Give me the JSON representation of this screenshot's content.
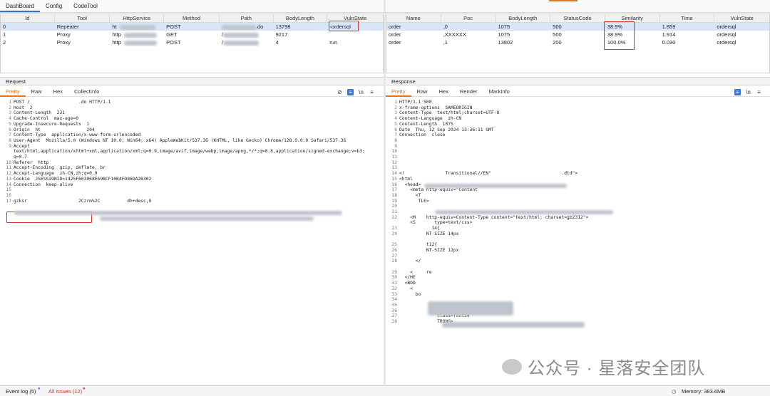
{
  "menu": {
    "tabs": [
      "DashBoard",
      "Config",
      "CodeTool"
    ]
  },
  "left_table": {
    "headers": [
      "Id",
      "Tool",
      "HttpService",
      "Method",
      "Path",
      "BodyLength",
      "VulnState"
    ],
    "rows": [
      {
        "id": "0",
        "tool": "Repeater",
        "http": "ht",
        "method": "POST",
        "path": ".do",
        "body": "13798",
        "vuln": "-ordersql"
      },
      {
        "id": "1",
        "tool": "Proxy",
        "http": "http",
        "method": "GET",
        "path": "/",
        "body": "9217",
        "vuln": ""
      },
      {
        "id": "2",
        "tool": "Proxy",
        "http": "http",
        "method": "POST",
        "path": "/",
        "body": "4",
        "vuln": "run"
      }
    ]
  },
  "right_table": {
    "headers": [
      "Name",
      "Poc",
      "BodyLength",
      "StatusCode",
      "Similarity",
      "Time",
      "VulnState"
    ],
    "rows": [
      {
        "name": "order",
        "poc": ",0",
        "body": "1075",
        "status": "500",
        "sim": "38.9%",
        "time": "1.859",
        "vuln": "ordersql"
      },
      {
        "name": "order",
        "poc": ",XXXXXX",
        "body": "1075",
        "status": "500",
        "sim": "38.9%",
        "time": "1.914",
        "vuln": "ordersql"
      },
      {
        "name": "order",
        "poc": ",1",
        "body": "13802",
        "status": "200",
        "sim": "100.0%",
        "time": "0.030",
        "vuln": "ordersql"
      }
    ]
  },
  "request": {
    "title": "Request",
    "tabs": [
      "Pretty",
      "Raw",
      "Hex",
      "CollectInfo"
    ],
    "lines": [
      "POST /                  .do HTTP/1.1",
      "Host  2",
      "Content-Length  231",
      "Cache-Control  max-age=0",
      "Upgrade-Insecure-Requests  1",
      "Origin  ht                 204",
      "Content-Type  application/x-www-form-urlencoded",
      "User-Agent  Mozilla/5.0 (Windows NT 10.0; Win64; x64) AppleWebKit/537.36 (KHTML, like Gecko) Chrome/128.0.0.0 Safari/537.36",
      "Accept",
      "text/html,application/xhtml+xml,application/xml;q=0.9,image/avif,image/webp,image/apng,*/*;q=0.8,application/signed-exchange;v=b3;",
      "q=0.7",
      "Referer  http",
      "Accept-Encoding  gzip, deflate, br",
      "Accept-Language  zh-CN,zh;q=0.9",
      "Cookie  JSESSIONID=1425F603068E69BCF10B4FD86DA2B302",
      "Connection  keep-alive",
      "",
      "",
      "gzksr                   2Czrm%2C          dh+desc,0"
    ],
    "line_numbers": [
      "1",
      "2",
      "3",
      "4",
      "5",
      "6",
      "7",
      "8",
      "9",
      "",
      "",
      "10",
      "11",
      "12",
      "13",
      "14",
      "15",
      "16",
      "17"
    ]
  },
  "response": {
    "title": "Response",
    "tabs": [
      "Pretty",
      "Raw",
      "Hex",
      "Render",
      "MarkInfo"
    ],
    "lines": [
      "HTTP/1.1 500",
      "x-frame-options  SAMEORIGIN",
      "Content-Type  text/html;charset=UTF-8",
      "Content-Language  zh-CN",
      "Content-Length  1075",
      "Date  Thu, 12 Sep 2024 13:36:11 GMT",
      "Connection  close",
      "",
      "",
      "",
      "",
      "",
      "",
      "<!               Transitional//EN\"                          .dtd\">",
      "<html",
      "  <head>",
      "    <meta http-equiv=\"Content",
      "      <T",
      "       TLE>",
      "",
      "",
      "    <M    http-equiv=Content-Type content=\"text/html; charset=gb2312\">",
      "    <S       type=text/css>",
      "            14{",
      "          NT-SIZE 14px",
      "",
      "          t12{",
      "          NT-SIZE 12px",
      "",
      "      </",
      "",
      "    <     re",
      "  </HE",
      "  <BOD",
      "    <",
      "      bo",
      "",
      "",
      "",
      "              class=font14",
      "              TRONG>"
    ],
    "line_numbers": [
      "1",
      "2",
      "3",
      "4",
      "5",
      "6",
      "7",
      "8",
      "9",
      "10",
      "11",
      "12",
      "13",
      "14",
      "15",
      "16",
      "17",
      "18",
      "19",
      "20",
      "21",
      "22",
      "",
      "23",
      "24",
      "",
      "25",
      "26",
      "27",
      "28",
      "",
      "29",
      "30",
      "31",
      "32",
      "33",
      "34",
      "35",
      "36",
      "37",
      "38"
    ]
  },
  "status": {
    "event_log": "Event log (5)",
    "all_issues": "All issues (12)",
    "memory": "Memory: 383.6MB"
  },
  "watermark": "公众号 · 星落安全团队",
  "colors": {
    "accent": "#e8741a",
    "highlight_box": "#d9302a",
    "selected_row": "#d9e6f7",
    "tab_active": "#2f6fd6"
  }
}
